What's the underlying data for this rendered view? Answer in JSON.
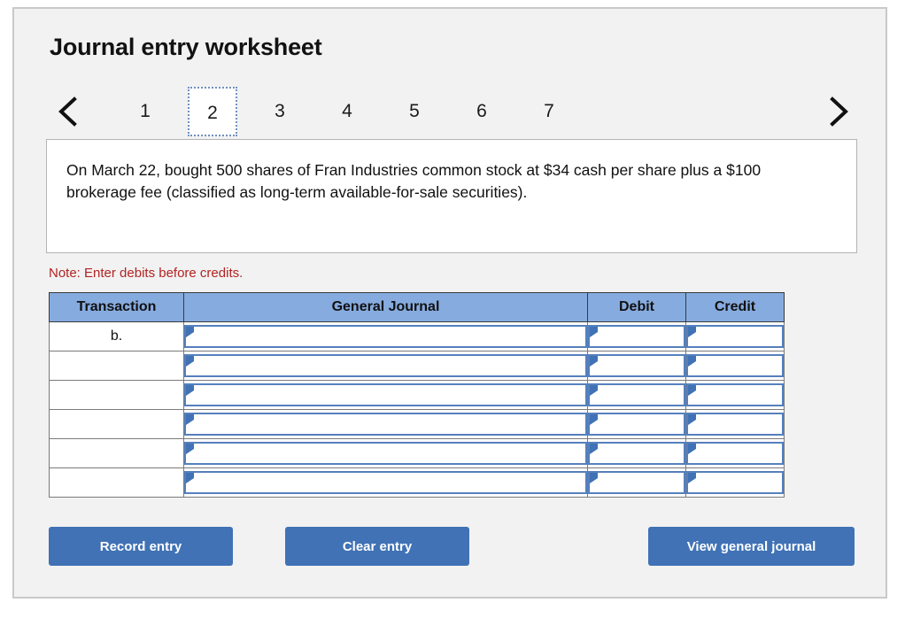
{
  "page": {
    "title": "Journal entry worksheet",
    "note": "Note: Enter debits before credits.",
    "prompt": "On March 22, bought 500 shares of Fran Industries common stock at $34 cash per share plus a $100 brokerage fee (classified as long-term available-for-sale securities)."
  },
  "pager": {
    "prev_icon": "chevron-left-icon",
    "next_icon": "chevron-right-icon",
    "active_tab": "2",
    "tabs": [
      {
        "label": "1",
        "active": false
      },
      {
        "label": "2",
        "active": true
      },
      {
        "label": "3",
        "active": false
      },
      {
        "label": "4",
        "active": false
      },
      {
        "label": "5",
        "active": false
      },
      {
        "label": "6",
        "active": false
      },
      {
        "label": "7",
        "active": false
      }
    ]
  },
  "table": {
    "headers": [
      "Transaction",
      "General Journal",
      "Debit",
      "Credit"
    ],
    "rows": [
      {
        "transaction": "b.",
        "general_journal": "",
        "debit": "",
        "credit": ""
      },
      {
        "transaction": "",
        "general_journal": "",
        "debit": "",
        "credit": ""
      },
      {
        "transaction": "",
        "general_journal": "",
        "debit": "",
        "credit": ""
      },
      {
        "transaction": "",
        "general_journal": "",
        "debit": "",
        "credit": ""
      },
      {
        "transaction": "",
        "general_journal": "",
        "debit": "",
        "credit": ""
      },
      {
        "transaction": "",
        "general_journal": "",
        "debit": "",
        "credit": ""
      }
    ]
  },
  "buttons": {
    "record": "Record entry",
    "clear": "Clear entry",
    "view": "View general journal"
  },
  "colors": {
    "header_blue": "#86abdf",
    "button_blue": "#4072b5",
    "field_border": "#5580bd",
    "note_red": "#b32222",
    "panel_bg": "#f2f2f2",
    "panel_border": "#c9c9c9"
  }
}
